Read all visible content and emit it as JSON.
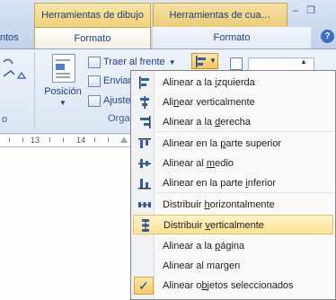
{
  "header": {
    "context_tab_drawing": "Herramientas de dibujo",
    "context_tab_picture": "Herramientas de cua…",
    "minimize_glyph": "–",
    "restore_glyph": "❐"
  },
  "tabs": {
    "left_partial": "ntos",
    "formato_drawing": "Formato",
    "formato_picture": "Formato",
    "help": "?"
  },
  "ribbon": {
    "position_label": "Posición",
    "bring_front": "Traer al frente",
    "send_back": "Enviar",
    "wrap": "Ajuste",
    "group_label": "Orga",
    "left_group_label": "o"
  },
  "ruler": {
    "labels": [
      "13",
      "14"
    ]
  },
  "align_menu": {
    "items": [
      {
        "pre": "Alinear a la ",
        "key": "i",
        "post": "zquierda"
      },
      {
        "pre": "Ali",
        "key": "n",
        "post": "ear verticalmente"
      },
      {
        "pre": "Alinear a la ",
        "key": "d",
        "post": "erecha"
      },
      {
        "pre": "Alinear en la ",
        "key": "p",
        "post": "arte superior"
      },
      {
        "pre": "Alinear al ",
        "key": "m",
        "post": "edio"
      },
      {
        "pre": "Alinear en la parte ",
        "key": "i",
        "post": "nferior"
      },
      {
        "pre": "Distribuir ",
        "key": "h",
        "post": "orizontalmente"
      },
      {
        "pre": "Distribuir ",
        "key": "v",
        "post": "erticalmente"
      },
      {
        "pre": "Alinear a la ",
        "key": "p",
        "post": "ágina"
      },
      {
        "pre": "Alinear al mar",
        "key": "g",
        "post": "en"
      },
      {
        "pre": "Alinear o",
        "key": "b",
        "post": "jetos seleccionados"
      }
    ],
    "highlighted_index": 7,
    "checked_index": 10,
    "check_glyph": "✓"
  },
  "colors": {
    "accent_highlight": "#ffe292",
    "context_tab": "#f2d17a",
    "text_blue": "#15428b"
  }
}
